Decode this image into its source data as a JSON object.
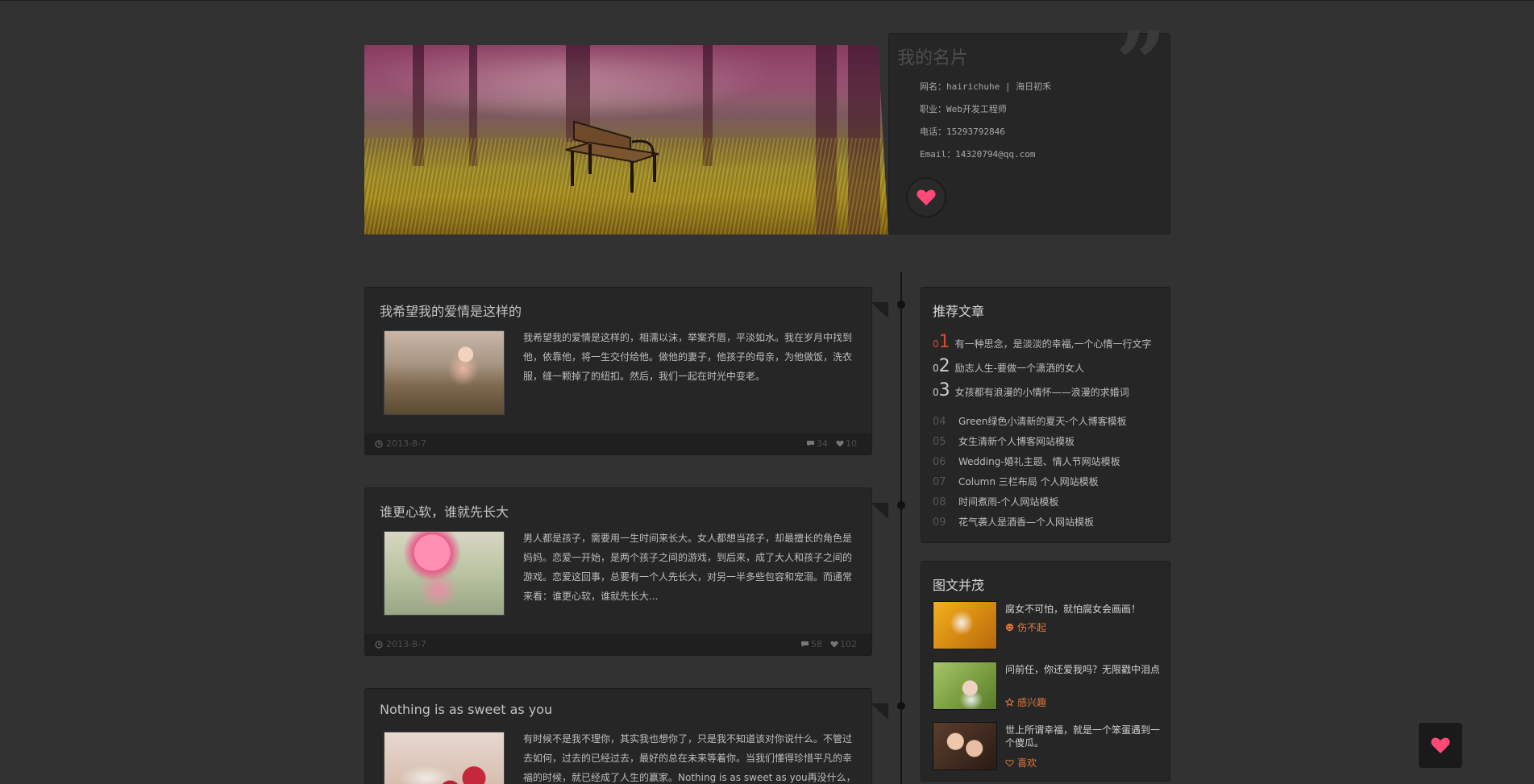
{
  "profile_card": {
    "title": "我的名片",
    "name_line": "网名：hairichuhe | 海日初禾",
    "job_line": "职业：Web开发工程师",
    "phone_line": "电话：15293792846",
    "email_line": "Email：14320794@qq.com"
  },
  "posts": [
    {
      "title": "我希望我的爱情是这样的",
      "text": "我希望我的爱情是这样的，相濡以沫，举案齐眉，平淡如水。我在岁月中找到他，依靠他，将一生交付给他。做他的妻子，他孩子的母亲，为他做饭，洗衣服，缝一颗掉了的纽扣。然后，我们一起在时光中变老。",
      "date": "2013-8-7",
      "comments": "34",
      "likes": "10"
    },
    {
      "title": "谁更心软，谁就先长大",
      "text": "男人都是孩子，需要用一生时间来长大。女人都想当孩子，却最擅长的角色是妈妈。恋爱一开始，是两个孩子之间的游戏，到后来，成了大人和孩子之间的游戏。恋爱这回事，总要有一个人先长大，对另一半多些包容和宠溺。而通常来看：谁更心软，谁就先长大...",
      "date": "2013-8-7",
      "comments": "58",
      "likes": "102"
    },
    {
      "title": "Nothing is as sweet as you",
      "text": "有时候不是我不理你，其实我也想你了，只是我不知道该对你说什么。不管过去如何，过去的已经过去，最好的总在未来等着你。当我们懂得珍惜平凡的幸福的时候，就已经成了人生的赢家。Nothing is as sweet as you再没什么，"
    }
  ],
  "recommended": {
    "title": "推荐文章",
    "items": [
      {
        "num_prefix": "0",
        "num_main": "1",
        "text": "有一种思念，是淡淡的幸福,一个心情一行文字"
      },
      {
        "num_prefix": "0",
        "num_main": "2",
        "text": "励志人生-要做一个潇洒的女人"
      },
      {
        "num_prefix": "0",
        "num_main": "3",
        "text": "女孩都有浪漫的小情怀——浪漫的求婚词"
      },
      {
        "num": "04",
        "text": "Green绿色小清新的夏天-个人博客模板"
      },
      {
        "num": "05",
        "text": "女生清新个人博客网站模板"
      },
      {
        "num": "06",
        "text": "Wedding-婚礼主题、情人节网站模板"
      },
      {
        "num": "07",
        "text": "Column 三栏布局 个人网站模板"
      },
      {
        "num": "08",
        "text": "时间煮雨-个人网站模板"
      },
      {
        "num": "09",
        "text": "花气袭人是酒香—个人网站模板"
      }
    ]
  },
  "gallery": {
    "title": "图文并茂",
    "items": [
      {
        "text": "腐女不可怕，就怕腐女会画画！",
        "meta": "伤不起",
        "meta_icon": "sad-face-icon"
      },
      {
        "text": "问前任，你还爱我吗？无限戳中泪点",
        "meta": "感兴趣",
        "meta_icon": "star-icon"
      },
      {
        "text": "世上所谓幸福，就是一个笨蛋遇到一个傻瓜。",
        "meta": "喜欢",
        "meta_icon": "heart-outline-icon"
      }
    ]
  },
  "colors": {
    "background": "#323232",
    "accent_pink": "#ff4a78",
    "accent_orange": "#e0783c",
    "rank_red": "#d94a2c"
  }
}
